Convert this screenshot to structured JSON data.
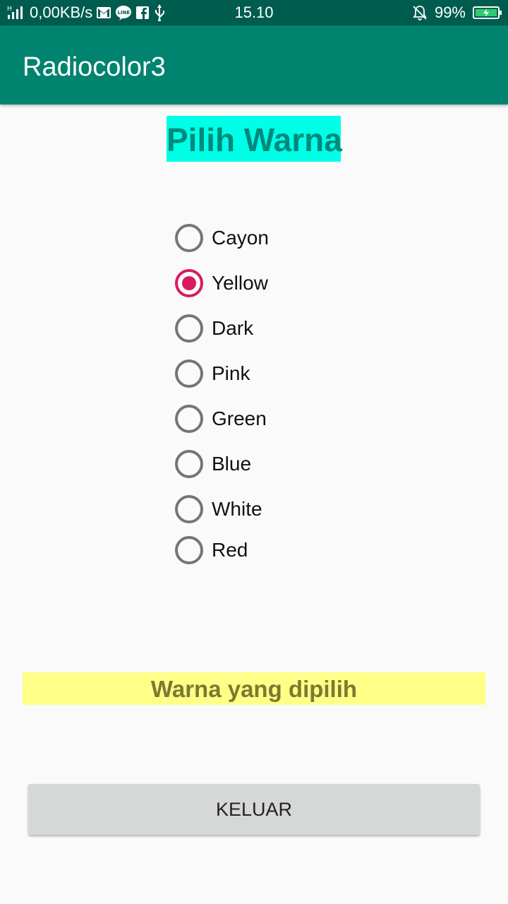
{
  "status_bar": {
    "network": "0,00KB/s",
    "time": "15.10",
    "battery": "99%",
    "icons": [
      "signal-icon",
      "gmail-icon",
      "line-icon",
      "facebook-icon",
      "usb-icon",
      "silent-icon",
      "battery-icon"
    ]
  },
  "app_bar": {
    "title": "Radiocolor3"
  },
  "heading": "Pilih Warna",
  "radio_options": [
    {
      "label": "Cayon",
      "checked": false
    },
    {
      "label": "Yellow",
      "checked": true
    },
    {
      "label": "Dark",
      "checked": false
    },
    {
      "label": "Pink",
      "checked": false
    },
    {
      "label": "Green",
      "checked": false
    },
    {
      "label": "Blue",
      "checked": false
    },
    {
      "label": "White",
      "checked": false
    },
    {
      "label": "Red",
      "checked": false
    }
  ],
  "result_label": "Warna yang dipilih",
  "exit_button": "KELUAR",
  "colors": {
    "status_bar": "#005c4e",
    "app_bar": "#00836f",
    "heading_bg": "#00ffe7",
    "heading_text": "#00897b",
    "accent": "#d81b60",
    "result_bg": "#ffff88"
  }
}
